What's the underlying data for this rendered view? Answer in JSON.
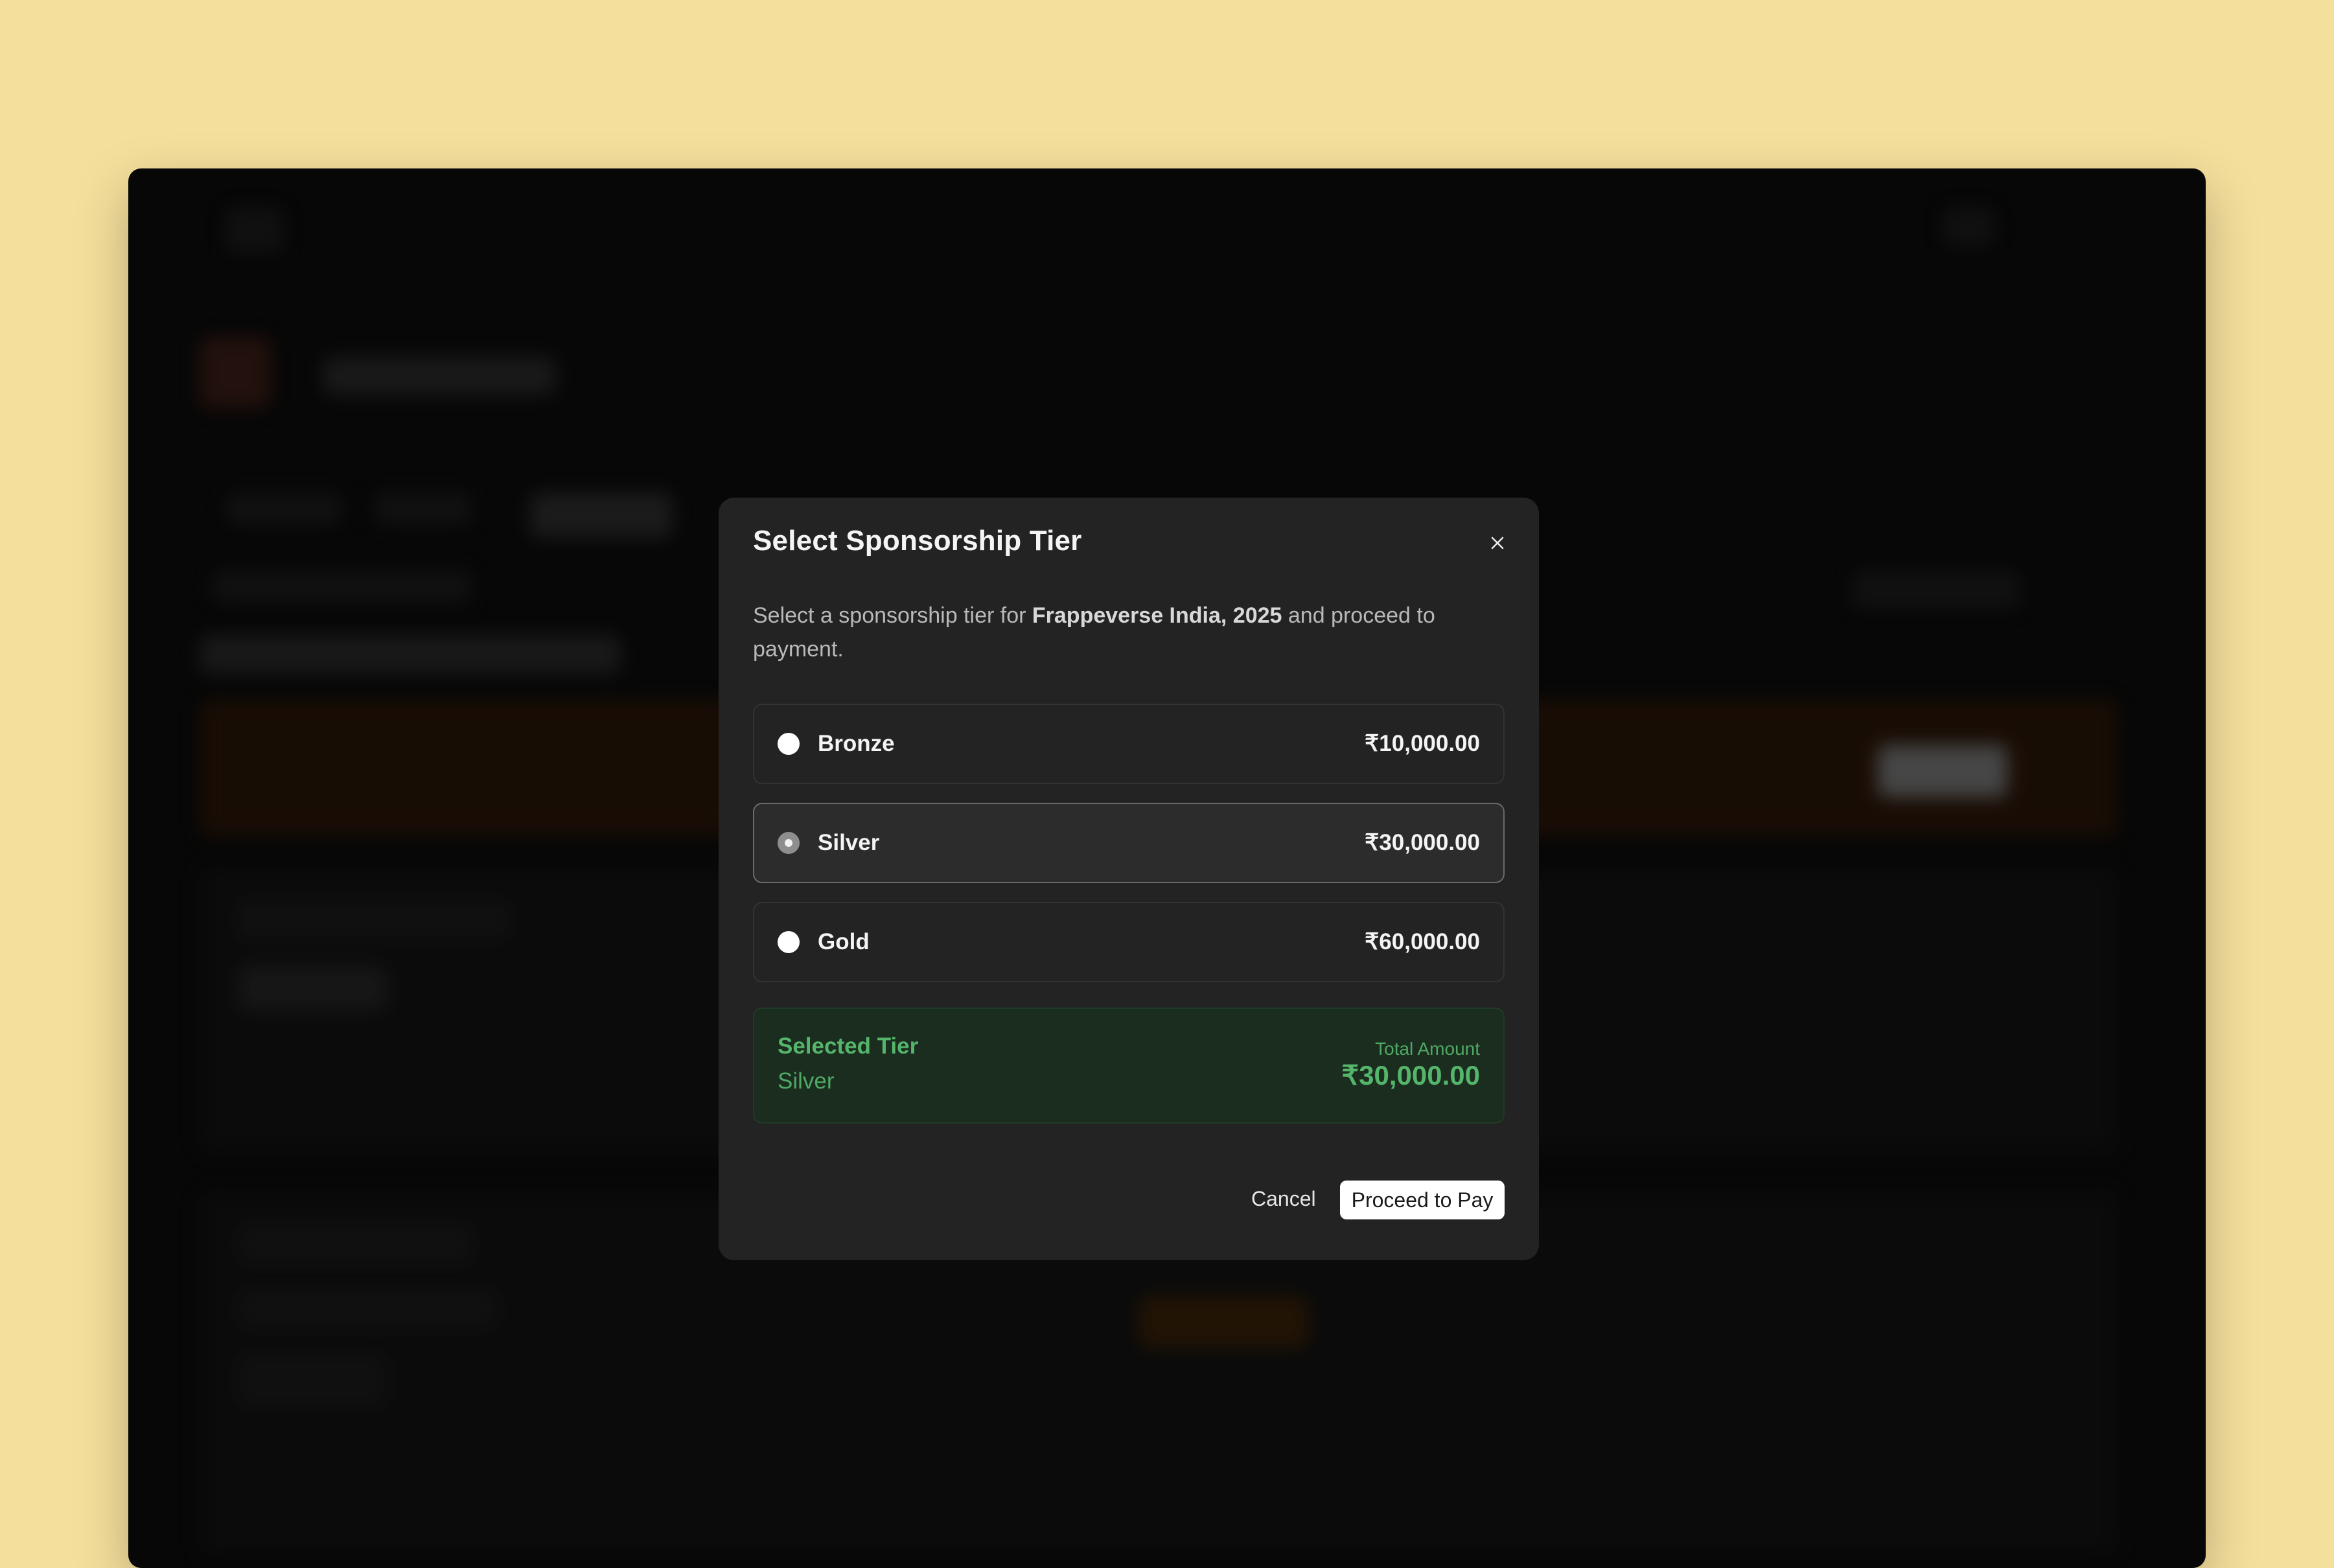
{
  "modal": {
    "title": "Select Sponsorship Tier",
    "description_prefix": "Select a sponsorship tier for ",
    "event_name": "Frappeverse India, 2025",
    "description_suffix": " and proceed to payment.",
    "tiers": [
      {
        "name": "Bronze",
        "price": "₹10,000.00",
        "selected": false
      },
      {
        "name": "Silver",
        "price": "₹30,000.00",
        "selected": true
      },
      {
        "name": "Gold",
        "price": "₹60,000.00",
        "selected": false
      }
    ],
    "summary": {
      "label": "Selected Tier",
      "tier": "Silver",
      "total_label": "Total Amount",
      "total": "₹30,000.00"
    },
    "cancel_label": "Cancel",
    "proceed_label": "Proceed to Pay"
  },
  "colors": {
    "page_background": "#f5df9c",
    "window_background": "#0b0b0b",
    "modal_background": "#232323",
    "summary_background": "#1b2d1f",
    "summary_text": "#55b56b"
  },
  "icons": {
    "close": "close-icon"
  }
}
